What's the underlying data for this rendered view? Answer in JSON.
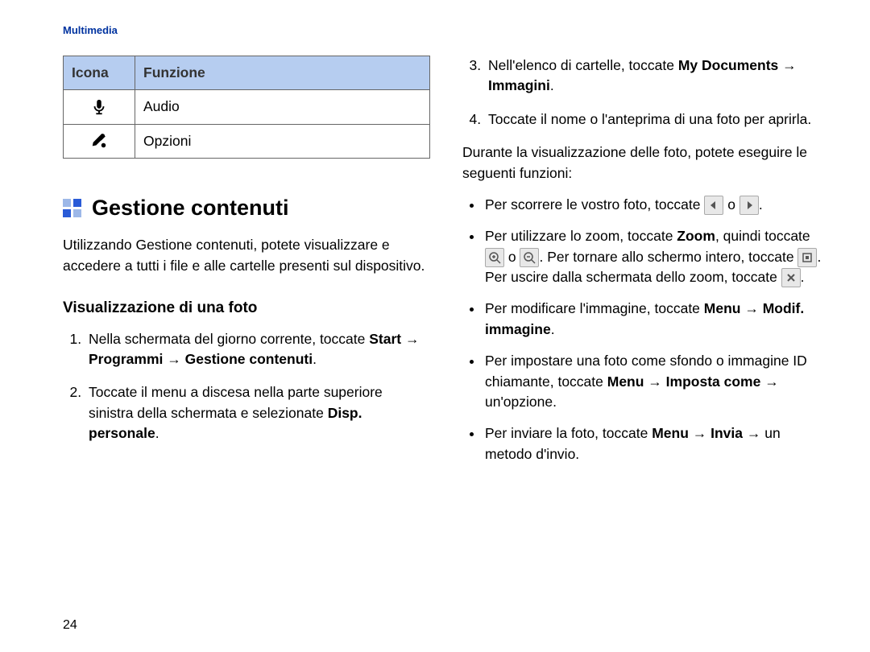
{
  "section_label": "Multimedia",
  "table": {
    "head_icon": "Icona",
    "head_func": "Funzione",
    "rows": [
      {
        "func": "Audio"
      },
      {
        "func": "Opzioni"
      }
    ]
  },
  "title": "Gestione contenuti",
  "intro": "Utilizzando Gestione contenuti, potete visualizzare e accedere a tutti i file e alle cartelle presenti sul dispositivo.",
  "subtitle": "Visualizzazione di una foto",
  "steps": {
    "s1a": "Nella schermata del giorno corrente, toccate ",
    "s1b": "Start → Programmi → Gestione contenuti",
    "s1c": ".",
    "s2a": "Toccate il menu a discesa nella parte superiore sinistra della schermata e selezionate ",
    "s2b": "Disp. personale",
    "s2c": ".",
    "s3a": "Nell'elenco di cartelle, toccate ",
    "s3b": "My Documents → Immagini",
    "s3c": ".",
    "s4": "Toccate il nome o l'anteprima di una foto per aprirla."
  },
  "para_during": "Durante la visualizzazione delle foto, potete eseguire le seguenti funzioni:",
  "bullets": {
    "b1a": "Per scorrere le vostro foto, toccate ",
    "b1b": " o ",
    "b1c": ".",
    "b2a": "Per utilizzare lo zoom, toccate ",
    "b2b": "Zoom",
    "b2c": ", quindi toccate ",
    "b2d": " o ",
    "b2e": ". Per tornare allo schermo intero, toccate ",
    "b2f": ". Per uscire dalla schermata dello zoom, toccate ",
    "b2g": ".",
    "b3a": "Per modificare l'immagine, toccate ",
    "b3b": "Menu → Modif. immagine",
    "b3c": ".",
    "b4a": "Per impostare una foto come sfondo o immagine ID chiamante, toccate ",
    "b4b": "Menu → Imposta come → ",
    "b4c": "un'opzione.",
    "b5a": "Per inviare la foto, toccate ",
    "b5b": "Menu → Invia → ",
    "b5c": "un metodo d'invio."
  },
  "page_number": "24"
}
